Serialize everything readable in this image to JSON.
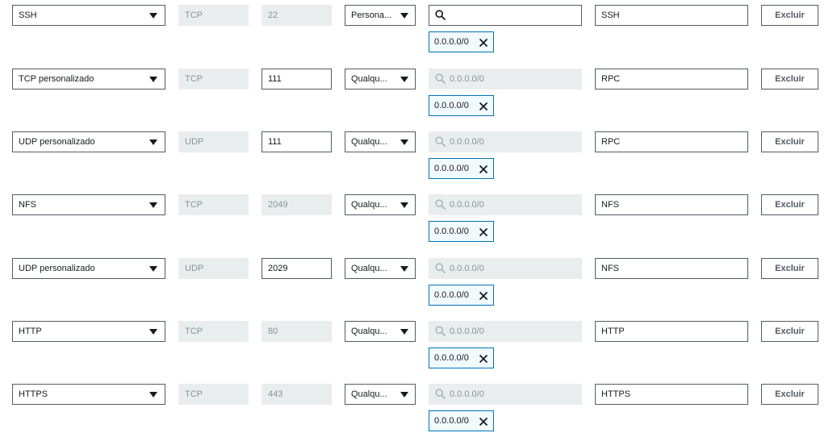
{
  "rules": [
    {
      "type": "SSH",
      "protocol": "TCP",
      "port": "22",
      "port_editable": false,
      "source": "Persona...",
      "search_placeholder": "",
      "search_active": true,
      "token": "0.0.0.0/0",
      "description": "SSH",
      "delete_label": "Excluir"
    },
    {
      "type": "TCP personalizado",
      "protocol": "TCP",
      "port": "111",
      "port_editable": true,
      "source": "Qualqu...",
      "search_placeholder": "0.0.0.0/0",
      "search_active": false,
      "token": "0.0.0.0/0",
      "description": "RPC",
      "delete_label": "Excluir"
    },
    {
      "type": "UDP personalizado",
      "protocol": "UDP",
      "port": "111",
      "port_editable": true,
      "source": "Qualqu...",
      "search_placeholder": "0.0.0.0/0",
      "search_active": false,
      "token": "0.0.0.0/0",
      "description": "RPC",
      "delete_label": "Excluir"
    },
    {
      "type": "NFS",
      "protocol": "TCP",
      "port": "2049",
      "port_editable": false,
      "source": "Qualqu...",
      "search_placeholder": "0.0.0.0/0",
      "search_active": false,
      "token": "0.0.0.0/0",
      "description": "NFS",
      "delete_label": "Excluir"
    },
    {
      "type": "UDP personalizado",
      "protocol": "UDP",
      "port": "2029",
      "port_editable": true,
      "source": "Qualqu...",
      "search_placeholder": "0.0.0.0/0",
      "search_active": false,
      "token": "0.0.0.0/0",
      "description": "NFS",
      "delete_label": "Excluir"
    },
    {
      "type": "HTTP",
      "protocol": "TCP",
      "port": "80",
      "port_editable": false,
      "source": "Qualqu...",
      "search_placeholder": "0.0.0.0/0",
      "search_active": false,
      "token": "0.0.0.0/0",
      "description": "HTTP",
      "delete_label": "Excluir"
    },
    {
      "type": "HTTPS",
      "protocol": "TCP",
      "port": "443",
      "port_editable": false,
      "source": "Qualqu...",
      "search_placeholder": "0.0.0.0/0",
      "search_active": false,
      "token": "0.0.0.0/0",
      "description": "HTTPS",
      "delete_label": "Excluir"
    }
  ],
  "icons": {
    "caret": "caret-down-icon",
    "search": "search-icon",
    "remove": "close-icon"
  },
  "colors": {
    "border": "#545b64",
    "disabled_bg": "#eaeded",
    "muted_text": "#879596",
    "token_border": "#0073bb",
    "token_bg": "#f1faff"
  }
}
